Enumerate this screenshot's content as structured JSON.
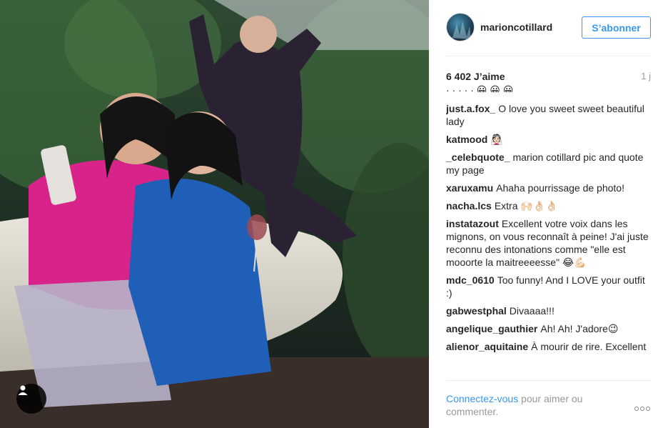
{
  "post": {
    "username": "marioncotillard",
    "follow_label": "S’abonner",
    "likes": "6 402 J’aime",
    "time": "1 j"
  },
  "comments": [
    {
      "user": "",
      "text": "· · · · · 😀 😀 😀"
    },
    {
      "user": "just.a.fox_",
      "text": "O love you sweet sweet beautiful lady"
    },
    {
      "user": "katmood",
      "text": "👰🏻"
    },
    {
      "user": "_celebquote_",
      "text": "marion cotillard pic and quote my page"
    },
    {
      "user": "xaruxamu",
      "text": "Ahaha pourrissage de photo!"
    },
    {
      "user": "nacha.lcs",
      "text": "Extra 🙌🏻👌🏻👌🏻"
    },
    {
      "user": "instatazout",
      "text": "Excellent votre voix dans les mignons, on vous reconnaît à peine! J'ai juste reconnu des intonations comme \"elle est mooorte la maitreeeesse\" 😂💪🏻"
    },
    {
      "user": "mdc_0610",
      "text": "Too funny! And I LOVE your outfit :)"
    },
    {
      "user": "gabwestphal",
      "text": "Divaaaa!!!"
    },
    {
      "user": "angelique_gauthier",
      "text": "Ah! Ah! J'adore😉"
    },
    {
      "user": "alienor_aquitaine",
      "text": "À mourir de rire. Excellent"
    }
  ],
  "footer": {
    "login_link": "Connectez-vous",
    "login_rest": " pour aimer ou commenter.",
    "more_label": "○○○"
  },
  "icons": {
    "tag": "person-tag-icon",
    "more": "more-options-icon"
  }
}
